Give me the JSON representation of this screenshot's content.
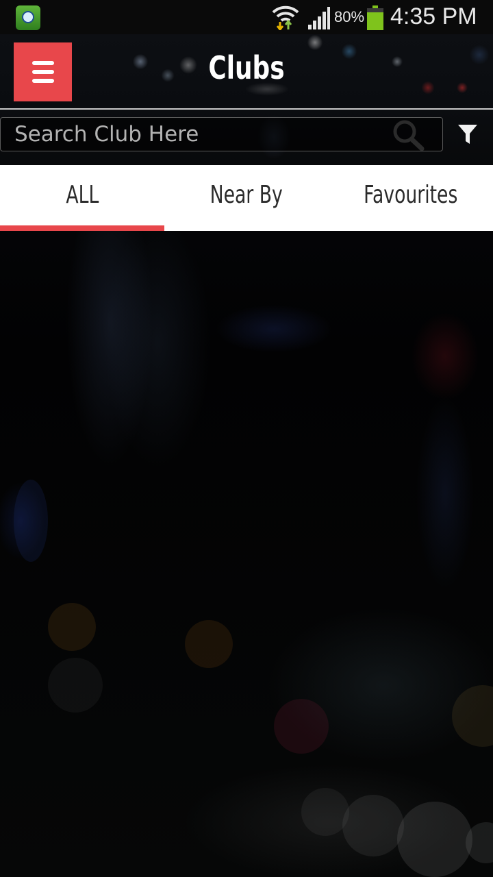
{
  "status_bar": {
    "battery_percent": "80%",
    "time": "4:35 PM",
    "icons": [
      "app-notification-icon",
      "wifi-icon",
      "signal-icon",
      "battery-icon"
    ]
  },
  "toolbar": {
    "title": "Clubs",
    "menu_icon": "hamburger-menu-icon"
  },
  "search": {
    "placeholder": "Search Club Here",
    "value": "",
    "search_icon": "search-icon",
    "filter_icon": "filter-icon"
  },
  "tabs": [
    {
      "label": "ALL",
      "active": true
    },
    {
      "label": "Near By",
      "active": false
    },
    {
      "label": "Favourites",
      "active": false
    }
  ],
  "colors": {
    "accent": "#e8474b",
    "status_bar": "#0a0a0a",
    "tab_background": "#ffffff",
    "tab_text": "#2b2b2b",
    "battery_green": "#7fc31c",
    "wifi_arrow_up": "#8bc34a",
    "wifi_arrow_down": "#e5b400"
  }
}
